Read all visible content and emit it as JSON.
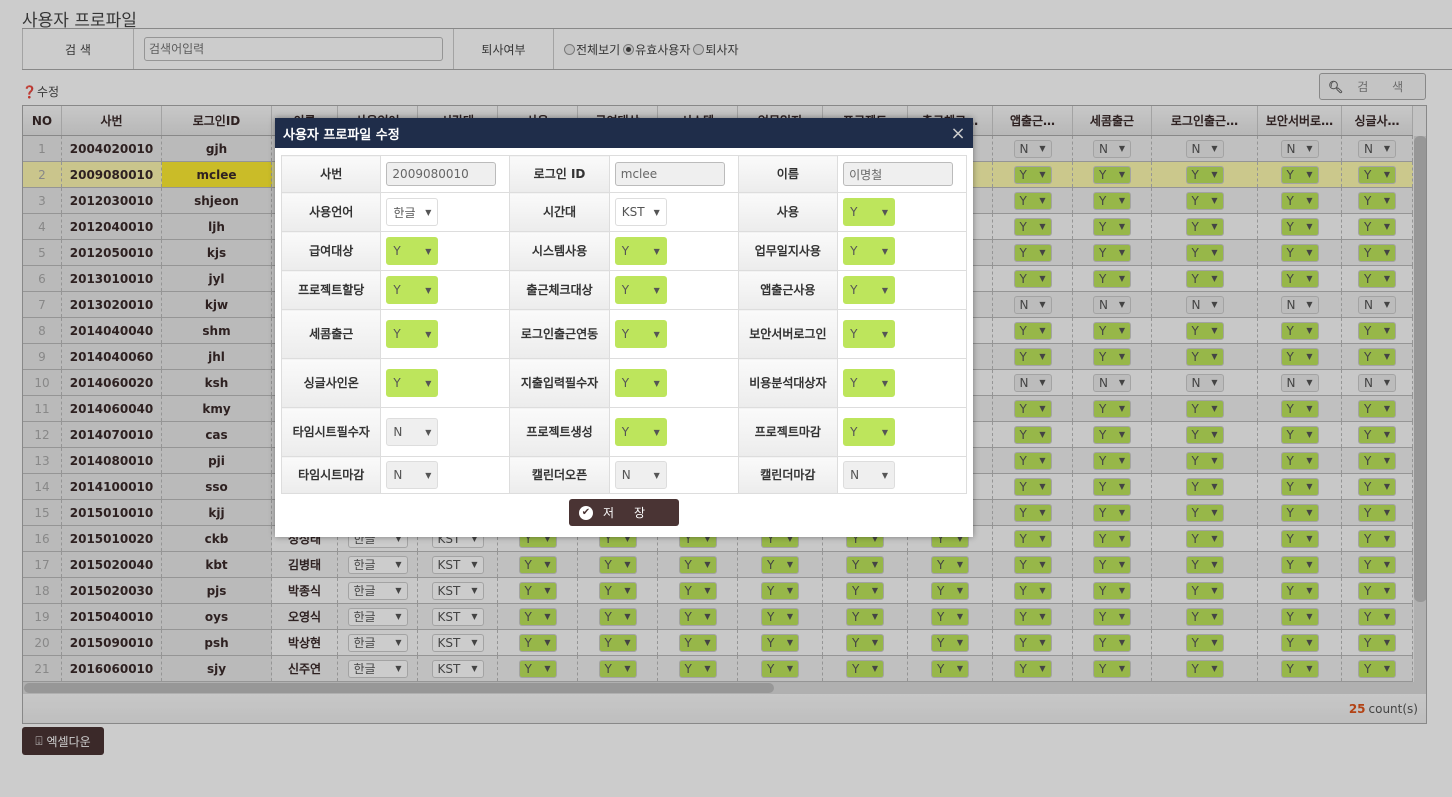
{
  "page_title": "사용자 프로파일",
  "filter": {
    "search_label": "검 색",
    "search_placeholder": "검색어입력",
    "retire_label": "퇴사여부",
    "radio_options": [
      "전체보기",
      "유효사용자",
      "퇴사자"
    ],
    "radio_selected": 1
  },
  "edit_help": "수정",
  "search_button": "검  색",
  "grid": {
    "columns": [
      "NO",
      "사번",
      "로그인ID",
      "이름",
      "사용언어",
      "시간대",
      "사용",
      "급여대상",
      "시스템",
      "업무일지",
      "프로젝트",
      "출근체크…",
      "앱출근…",
      "세콤출근",
      "로그인출근…",
      "보안서버로…",
      "싱글사…"
    ],
    "selected_row": 2,
    "rows": [
      {
        "no": "1",
        "emp": "2004020010",
        "login": "gjh",
        "name": "",
        "lang": "",
        "tz": "",
        "flag": "N"
      },
      {
        "no": "2",
        "emp": "2009080010",
        "login": "mclee",
        "name": "",
        "lang": "",
        "tz": "",
        "flag": "Y"
      },
      {
        "no": "3",
        "emp": "2012030010",
        "login": "shjeon",
        "name": "",
        "lang": "",
        "tz": "",
        "flag": "Y"
      },
      {
        "no": "4",
        "emp": "2012040010",
        "login": "ljh",
        "name": "",
        "lang": "",
        "tz": "",
        "flag": "Y"
      },
      {
        "no": "5",
        "emp": "2012050010",
        "login": "kjs",
        "name": "",
        "lang": "",
        "tz": "",
        "flag": "Y"
      },
      {
        "no": "6",
        "emp": "2013010010",
        "login": "jyl",
        "name": "",
        "lang": "",
        "tz": "",
        "flag": "Y"
      },
      {
        "no": "7",
        "emp": "2013020010",
        "login": "kjw",
        "name": "",
        "lang": "",
        "tz": "",
        "flag": "N"
      },
      {
        "no": "8",
        "emp": "2014040040",
        "login": "shm",
        "name": "",
        "lang": "",
        "tz": "",
        "flag": "Y"
      },
      {
        "no": "9",
        "emp": "2014040060",
        "login": "jhl",
        "name": "",
        "lang": "",
        "tz": "",
        "flag": "Y"
      },
      {
        "no": "10",
        "emp": "2014060020",
        "login": "ksh",
        "name": "",
        "lang": "",
        "tz": "",
        "flag": "N"
      },
      {
        "no": "11",
        "emp": "2014060040",
        "login": "kmy",
        "name": "",
        "lang": "",
        "tz": "",
        "flag": "Y"
      },
      {
        "no": "12",
        "emp": "2014070010",
        "login": "cas",
        "name": "",
        "lang": "",
        "tz": "",
        "flag": "Y"
      },
      {
        "no": "13",
        "emp": "2014080010",
        "login": "pji",
        "name": "",
        "lang": "",
        "tz": "",
        "flag": "Y"
      },
      {
        "no": "14",
        "emp": "2014100010",
        "login": "sso",
        "name": "",
        "lang": "",
        "tz": "",
        "flag": "Y"
      },
      {
        "no": "15",
        "emp": "2015010010",
        "login": "kjj",
        "name": "",
        "lang": "",
        "tz": "",
        "flag": "Y"
      },
      {
        "no": "16",
        "emp": "2015010020",
        "login": "ckb",
        "name": "정성태",
        "lang": "한글",
        "tz": "KST",
        "flag": "Y"
      },
      {
        "no": "17",
        "emp": "2015020040",
        "login": "kbt",
        "name": "김병태",
        "lang": "한글",
        "tz": "KST",
        "flag": "Y"
      },
      {
        "no": "18",
        "emp": "2015020030",
        "login": "pjs",
        "name": "박종식",
        "lang": "한글",
        "tz": "KST",
        "flag": "Y"
      },
      {
        "no": "19",
        "emp": "2015040010",
        "login": "oys",
        "name": "오영식",
        "lang": "한글",
        "tz": "KST",
        "flag": "Y"
      },
      {
        "no": "20",
        "emp": "2015090010",
        "login": "psh",
        "name": "박상현",
        "lang": "한글",
        "tz": "KST",
        "flag": "Y"
      },
      {
        "no": "21",
        "emp": "2016060010",
        "login": "sjy",
        "name": "신주연",
        "lang": "한글",
        "tz": "KST",
        "flag": "Y"
      }
    ],
    "count": "25",
    "count_suffix": "count(s)"
  },
  "excel_button": "엑셀다운",
  "modal": {
    "title": "사용자 프로파일 수정",
    "close": "×",
    "fields": [
      [
        {
          "label": "사번",
          "type": "input",
          "value": "2009080010"
        },
        {
          "label": "로그인 ID",
          "type": "input",
          "value": "mclee"
        },
        {
          "label": "이름",
          "type": "input",
          "value": "이명철"
        }
      ],
      [
        {
          "label": "사용언어",
          "type": "select",
          "value": "한글"
        },
        {
          "label": "시간대",
          "type": "select",
          "value": "KST"
        },
        {
          "label": "사용",
          "type": "yn",
          "value": "Y"
        }
      ],
      [
        {
          "label": "급여대상",
          "type": "yn",
          "value": "Y"
        },
        {
          "label": "시스템사용",
          "type": "yn",
          "value": "Y"
        },
        {
          "label": "업무일지사용",
          "type": "yn",
          "value": "Y"
        }
      ],
      [
        {
          "label": "프로젝트할당",
          "type": "yn",
          "value": "Y"
        },
        {
          "label": "출근체크대상",
          "type": "yn",
          "value": "Y"
        },
        {
          "label": "앱출근사용",
          "type": "yn",
          "value": "Y"
        }
      ],
      [
        {
          "label": "세콤출근",
          "type": "yn",
          "value": "Y"
        },
        {
          "label": "로그인출근연동",
          "type": "yn",
          "value": "Y"
        },
        {
          "label": "보안서버로그인",
          "type": "yn",
          "value": "Y"
        }
      ],
      [
        {
          "label": "싱글사인온",
          "type": "yn",
          "value": "Y"
        },
        {
          "label": "지출입력필수자",
          "type": "yn",
          "value": "Y"
        },
        {
          "label": "비용분석대상자",
          "type": "yn",
          "value": "Y"
        }
      ],
      [
        {
          "label": "타임시트필수자",
          "type": "yn",
          "value": "N"
        },
        {
          "label": "프로젝트생성",
          "type": "yn",
          "value": "Y"
        },
        {
          "label": "프로젝트마감",
          "type": "yn",
          "value": "Y"
        }
      ],
      [
        {
          "label": "타임시트마감",
          "type": "yn",
          "value": "N"
        },
        {
          "label": "캘린더오픈",
          "type": "yn",
          "value": "N"
        },
        {
          "label": "캘린더마감",
          "type": "yn",
          "value": "N"
        }
      ]
    ],
    "save_label": "저장"
  }
}
